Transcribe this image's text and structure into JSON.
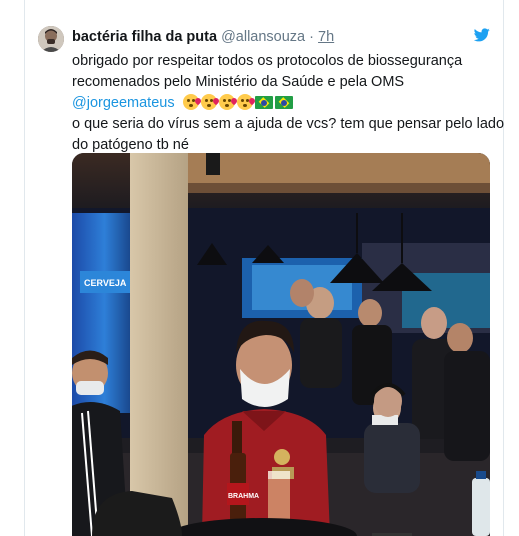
{
  "tweet": {
    "display_name": "bactéria filha da puta",
    "handle": "@allansouza",
    "separator": "·",
    "time": "7h",
    "lines": [
      "obrigado por respeitar todos os protocolos de biossegurança",
      "recomenados pelo Ministério da Saúde e pela OMS",
      "o que seria do vírus sem a ajuda de vcs? tem que pensar pelo lado",
      "do patógeno tb né"
    ],
    "mention": "@jorgeemateus",
    "emojis": [
      "winking-face-with-kiss-icon",
      "winking-face-with-kiss-icon",
      "face-blowing-kiss-icon",
      "face-blowing-kiss-icon",
      "brazil-flag-icon",
      "brazil-flag-icon"
    ]
  },
  "photo": {
    "sign_text": "CERVEJA",
    "bottle_label": "BRAHMA",
    "shirt_badge": "BRAHMA"
  },
  "colors": {
    "link": "#1b95e0",
    "twitter_blue": "#1da1f2",
    "text_secondary": "#657786"
  }
}
